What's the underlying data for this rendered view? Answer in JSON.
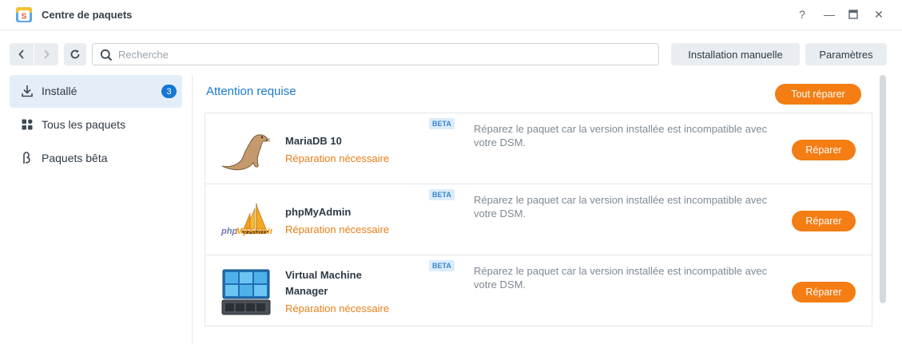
{
  "window": {
    "title": "Centre de paquets",
    "help_glyph": "?",
    "minimize_glyph": "—",
    "close_glyph": "✕"
  },
  "toolbar": {
    "search_placeholder": "Recherche",
    "manual_install_label": "Installation manuelle",
    "settings_label": "Paramètres"
  },
  "sidebar": {
    "items": [
      {
        "label": "Installé",
        "icon": "download-icon",
        "badge": "3",
        "active": true
      },
      {
        "label": "Tous les paquets",
        "icon": "grid-icon",
        "active": false
      },
      {
        "label": "Paquets bêta",
        "icon": "beta-icon",
        "active": false
      }
    ]
  },
  "main": {
    "section_title": "Attention requise",
    "repair_all_label": "Tout réparer",
    "packages": [
      {
        "name": "MariaDB 10",
        "status": "Réparation nécessaire",
        "beta": "BETA",
        "description": "Réparez le paquet car la version installée est incompatible avec votre DSM.",
        "repair_label": "Réparer",
        "icon": "mariadb-seal-icon"
      },
      {
        "name": "phpMyAdmin",
        "status": "Réparation nécessaire",
        "beta": "BETA",
        "description": "Réparez le paquet car la version installée est incompatible avec votre DSM.",
        "repair_label": "Réparer",
        "icon": "phpmyadmin-sailboat-icon"
      },
      {
        "name": "Virtual Machine Manager",
        "status": "Réparation nécessaire",
        "beta": "BETA",
        "description": "Réparez le paquet car la version installée est incompatible avec votre DSM.",
        "repair_label": "Réparer",
        "icon": "vmm-server-icon"
      }
    ]
  },
  "colors": {
    "accent_orange": "#f47d14",
    "link_blue": "#1b7bcf",
    "badge_blue": "#1677d2",
    "active_bg": "#e3eef9"
  }
}
